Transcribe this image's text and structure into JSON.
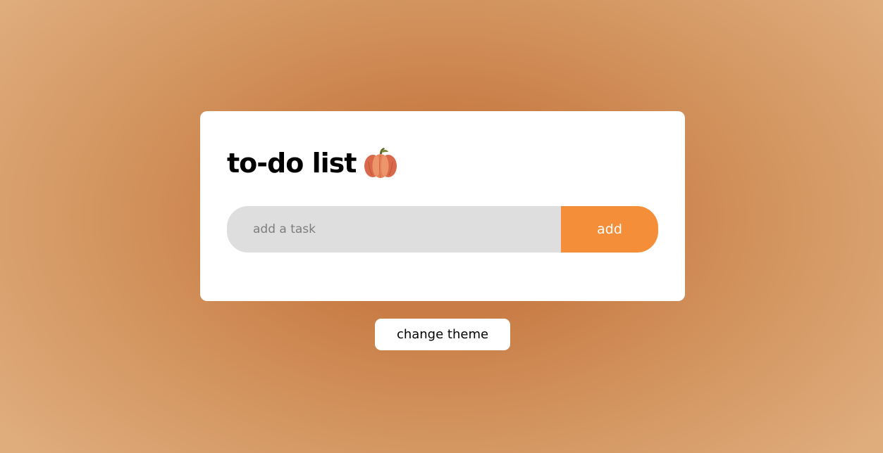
{
  "card": {
    "title": "to-do list",
    "title_icon": "pumpkin-icon"
  },
  "task_form": {
    "input_value": "",
    "input_placeholder": "add a task",
    "add_label": "add"
  },
  "theme": {
    "change_label": "change theme"
  },
  "colors": {
    "accent": "#f48e38",
    "input_background": "#dedede",
    "card_background": "#ffffff",
    "page_background_center": "#c87a42",
    "page_background_edge": "#dfac7c"
  }
}
